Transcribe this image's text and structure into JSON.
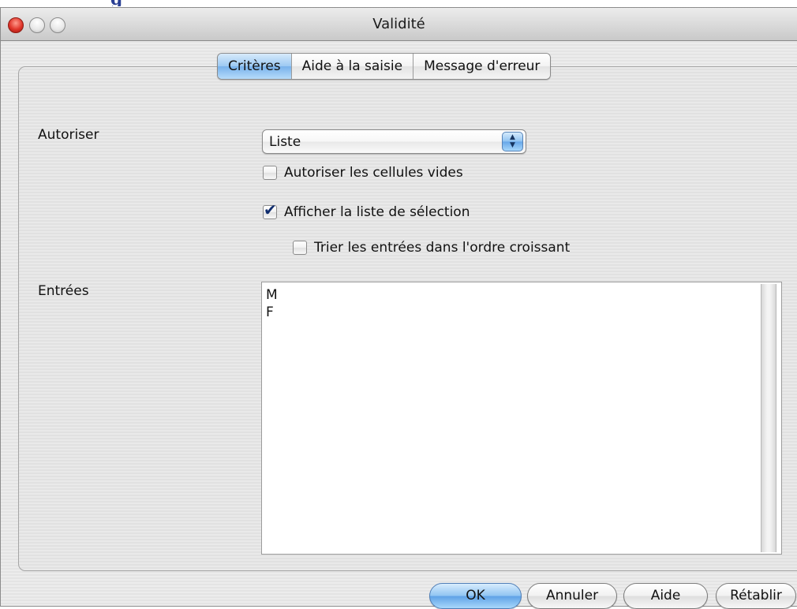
{
  "page_heading_fragment": "g",
  "window": {
    "title": "Validité"
  },
  "tabs": [
    {
      "label": "Critères",
      "active": true
    },
    {
      "label": "Aide à la saisie",
      "active": false
    },
    {
      "label": "Message d'erreur",
      "active": false
    }
  ],
  "criteria": {
    "allow_label": "Autoriser",
    "allow_select_value": "Liste",
    "allow_empty_label": "Autoriser les cellules vides",
    "allow_empty_checked": false,
    "show_list_label": "Afficher la liste de sélection",
    "show_list_checked": true,
    "sort_label": "Trier les entrées dans l'ordre croissant",
    "sort_checked": false,
    "entries_label": "Entrées",
    "entries": [
      "M",
      "F"
    ]
  },
  "buttons": {
    "ok": "OK",
    "cancel": "Annuler",
    "help": "Aide",
    "reset": "Rétablir"
  },
  "colors": {
    "accent_blue": "#78b1eb",
    "close_red": "#e0352a"
  },
  "icons": {
    "select_arrow": "up-down-chevron-icon",
    "checkmark": "checkmark-icon"
  }
}
